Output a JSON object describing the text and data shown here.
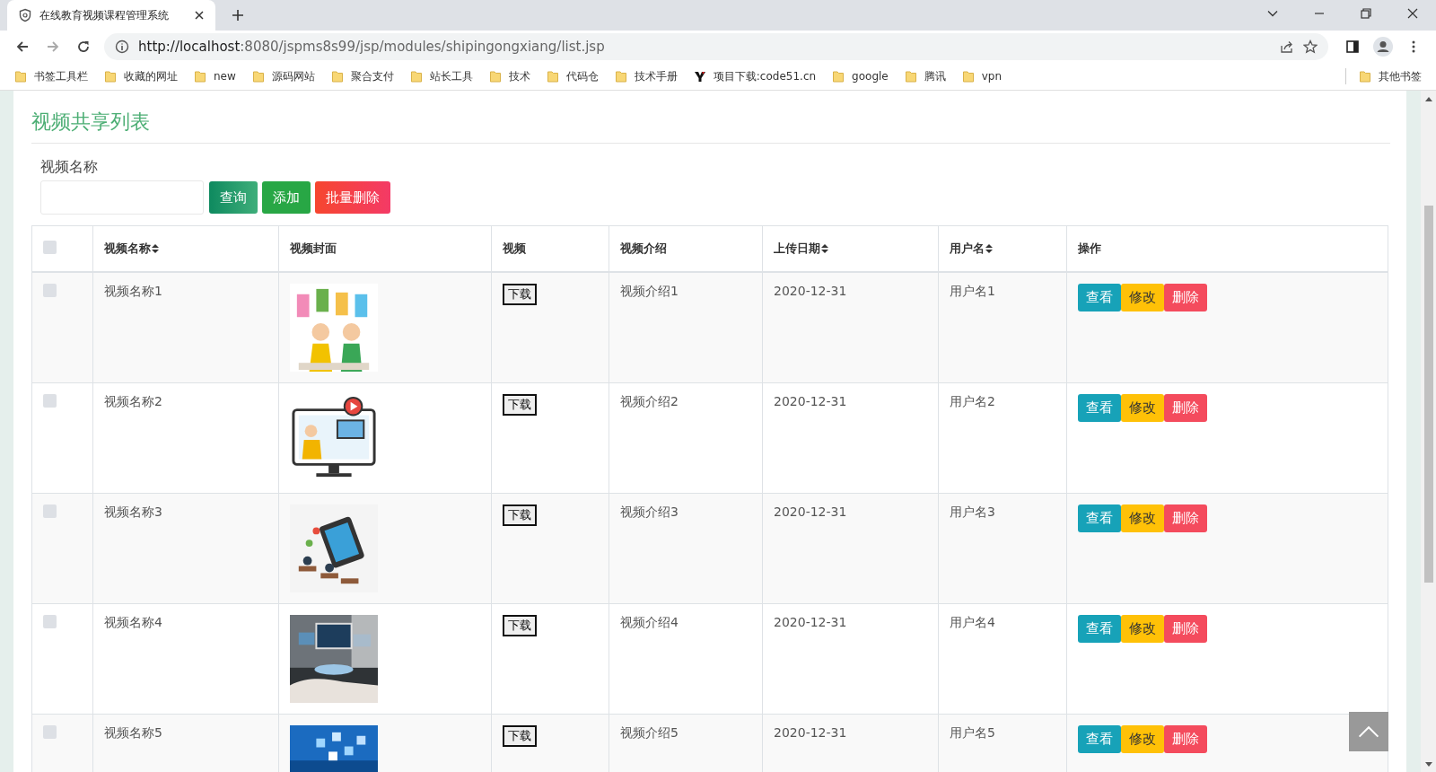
{
  "browser": {
    "tab_title": "在线教育视频课程管理系统",
    "url_host": "http://localhost",
    "url_rest": ":8080/jspms8s99/jsp/modules/shipingongxiang/list.jsp",
    "bookmarks": [
      {
        "label": "书签工具栏",
        "kind": "folder"
      },
      {
        "label": "收藏的网址",
        "kind": "folder"
      },
      {
        "label": "new",
        "kind": "folder"
      },
      {
        "label": "源码网站",
        "kind": "folder"
      },
      {
        "label": "聚合支付",
        "kind": "folder"
      },
      {
        "label": "站长工具",
        "kind": "folder"
      },
      {
        "label": "技术",
        "kind": "folder"
      },
      {
        "label": "代码仓",
        "kind": "folder"
      },
      {
        "label": "技术手册",
        "kind": "folder"
      },
      {
        "label": "项目下载:code51.cn",
        "kind": "site"
      },
      {
        "label": "google",
        "kind": "folder"
      },
      {
        "label": "腾讯",
        "kind": "folder"
      },
      {
        "label": "vpn",
        "kind": "folder"
      }
    ],
    "other_bookmarks": "其他书签"
  },
  "page": {
    "title": "视频共享列表",
    "search_label": "视频名称",
    "buttons": [
      {
        "label": "查询",
        "kind": "search"
      },
      {
        "label": "添加",
        "kind": "add"
      },
      {
        "label": "批量删除",
        "kind": "delete"
      }
    ],
    "table": {
      "select_all": {
        "checked": false
      },
      "columns": [
        {
          "label": "视频名称",
          "sortable": true
        },
        {
          "label": "视频封面",
          "sortable": false
        },
        {
          "label": "视频",
          "sortable": false
        },
        {
          "label": "视频介绍",
          "sortable": false
        },
        {
          "label": "上传日期",
          "sortable": true
        },
        {
          "label": "用户名",
          "sortable": true
        },
        {
          "label": "操作",
          "sortable": false
        }
      ],
      "rows": [
        {
          "checked": false,
          "name": "视频名称1",
          "download": "下载",
          "intro": "视频介绍1",
          "date": "2020-12-31",
          "user": "用户名1",
          "actions": [
            {
              "label": "查看",
              "kind": "view"
            },
            {
              "label": "修改",
              "kind": "edit"
            },
            {
              "label": "删除",
              "kind": "delete"
            }
          ]
        },
        {
          "checked": false,
          "name": "视频名称2",
          "download": "下载",
          "intro": "视频介绍2",
          "date": "2020-12-31",
          "user": "用户名2",
          "actions": [
            {
              "label": "查看",
              "kind": "view"
            },
            {
              "label": "修改",
              "kind": "edit"
            },
            {
              "label": "删除",
              "kind": "delete"
            }
          ]
        },
        {
          "checked": false,
          "name": "视频名称3",
          "download": "下载",
          "intro": "视频介绍3",
          "date": "2020-12-31",
          "user": "用户名3",
          "actions": [
            {
              "label": "查看",
              "kind": "view"
            },
            {
              "label": "修改",
              "kind": "edit"
            },
            {
              "label": "删除",
              "kind": "delete"
            }
          ]
        },
        {
          "checked": false,
          "name": "视频名称4",
          "download": "下载",
          "intro": "视频介绍4",
          "date": "2020-12-31",
          "user": "用户名4",
          "actions": [
            {
              "label": "查看",
              "kind": "view"
            },
            {
              "label": "修改",
              "kind": "edit"
            },
            {
              "label": "删除",
              "kind": "delete"
            }
          ]
        },
        {
          "checked": false,
          "name": "视频名称5",
          "download": "下载",
          "intro": "视频介绍5",
          "date": "2020-12-31",
          "user": "用户名5",
          "actions": [
            {
              "label": "查看",
              "kind": "view"
            },
            {
              "label": "修改",
              "kind": "edit"
            },
            {
              "label": "删除",
              "kind": "delete"
            }
          ]
        }
      ]
    }
  }
}
